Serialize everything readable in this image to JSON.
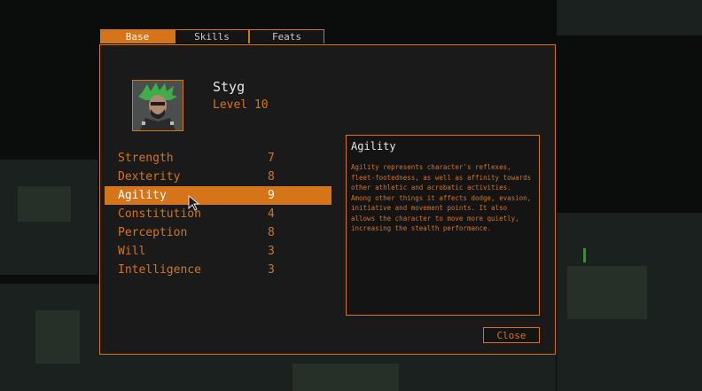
{
  "tabs": [
    {
      "label": "Base"
    },
    {
      "label": "Skills"
    },
    {
      "label": "Feats"
    }
  ],
  "character": {
    "name": "Styg",
    "level": "Level 10"
  },
  "stats": [
    {
      "label": "Strength",
      "value": "7"
    },
    {
      "label": "Dexterity",
      "value": "8"
    },
    {
      "label": "Agility",
      "value": "9"
    },
    {
      "label": "Constitution",
      "value": "4"
    },
    {
      "label": "Perception",
      "value": "8"
    },
    {
      "label": "Will",
      "value": "3"
    },
    {
      "label": "Intelligence",
      "value": "3"
    }
  ],
  "selected_stat": "Agility",
  "description": {
    "title": "Agility",
    "text": "Agility represents character's reflexes, fleet-footedness, as well as affinity towards other athletic and acrobatic activities. Among other things it affects dodge, evasion, initiative and movement points. It also allows the character to move more quietly, increasing the stealth performance."
  },
  "close_label": "Close",
  "colors": {
    "accent": "#d6741a",
    "panel": "#1a1a1a",
    "text_light": "#e6e6e6"
  },
  "icons": {
    "portrait": "character-portrait",
    "cursor": "mouse-pointer-icon"
  }
}
